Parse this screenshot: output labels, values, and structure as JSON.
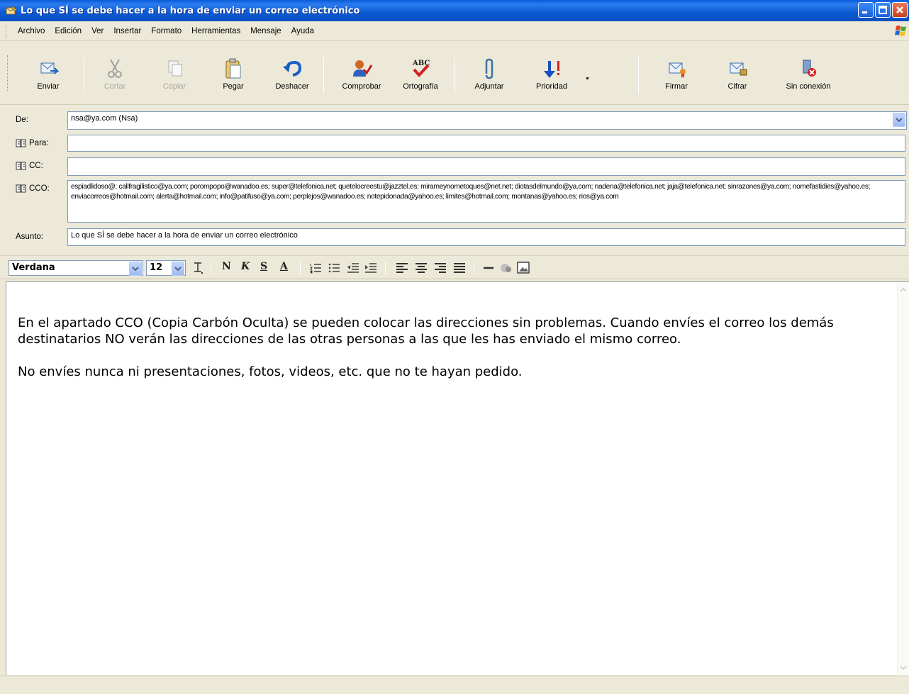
{
  "window": {
    "title": "Lo que SÍ se debe hacer a la hora de enviar un correo electrónico"
  },
  "menu": [
    "Archivo",
    "Edición",
    "Ver",
    "Insertar",
    "Formato",
    "Herramientas",
    "Mensaje",
    "Ayuda"
  ],
  "toolbar": {
    "enviar": "Enviar",
    "cortar": "Cortar",
    "copiar": "Copiar",
    "pegar": "Pegar",
    "deshacer": "Deshacer",
    "comprobar": "Comprobar",
    "ortografia": "Ortografía",
    "adjuntar": "Adjuntar",
    "prioridad": "Prioridad",
    "firmar": "Firmar",
    "cifrar": "Cifrar",
    "sin_conexion": "Sin conexión"
  },
  "header": {
    "de_label": "De:",
    "de_value": "nsa@ya.com   (Nsa)",
    "para_label": "Para:",
    "para_value": "",
    "cc_label": "CC:",
    "cc_value": "",
    "cco_label": "CCO:",
    "cco_value": "espiadlidoso@; califragilistico@ya.com; porompopo@wanadoo.es; super@telefonica.net; quetelocreestu@jazztel.es; mirameynometoques@net.net; diotasdelmundo@ya.com; nadena@telefonica.net; jaja@telefonica.net; sinrazones@ya.com; nomefastidies@yahoo.es; enviacorreos@hotmail.com; alerta@hotmail.com; info@patifuso@ya.com; perplejos@wanadoo.es; notepidonada@yahoo.es; limites@hotmail.com; montanas@yahoo.es; rios@ya.com",
    "asunto_label": "Asunto:",
    "asunto_value": "Lo que SÍ se debe hacer a la hora de enviar un correo electrónico"
  },
  "format": {
    "font": "Verdana",
    "size": "12",
    "bold": "N",
    "italic": "K",
    "underline": "S",
    "color": "A"
  },
  "body": {
    "paragraph1": "En el apartado CCO (Copia Carbón Oculta) se pueden colocar las direcciones sin problemas. Cuando envíes el correo los demás destinatarios NO verán las direcciones de las otras personas a las que les has enviado el mismo correo.",
    "paragraph2": "No envíes nunca ni presentaciones, fotos, videos, etc. que no te hayan pedido."
  }
}
